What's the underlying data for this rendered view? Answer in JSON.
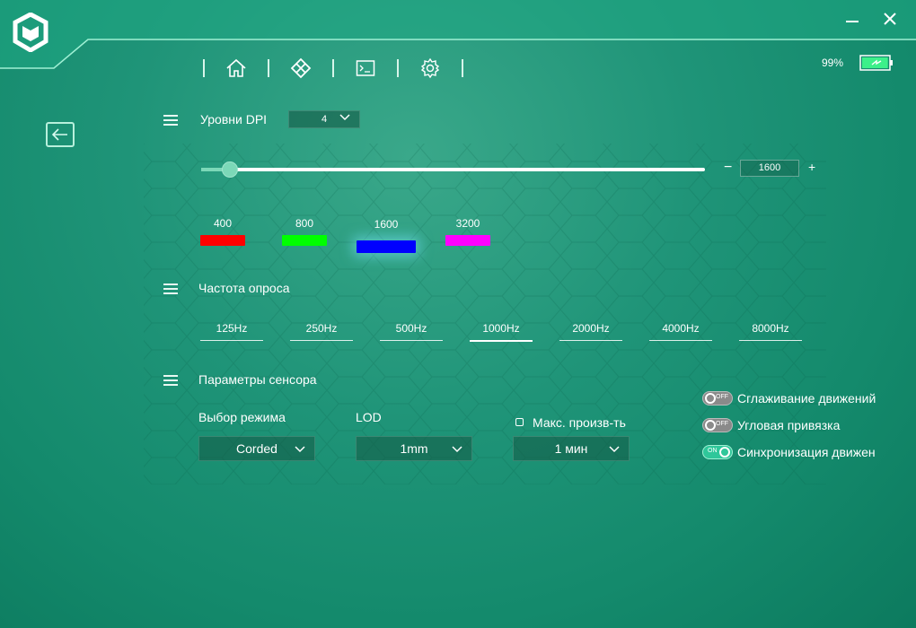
{
  "window": {
    "battery_percent": "99%",
    "battery_level": 0.99
  },
  "nav": {
    "icons": [
      "home-icon",
      "grid-icon",
      "terminal-icon",
      "gear-icon"
    ]
  },
  "dpi": {
    "title": "Уровни DPI",
    "levels_count": "4",
    "slider_value": "1600",
    "slider_min": 100,
    "slider_max": 26000,
    "minus": "−",
    "plus": "+",
    "levels": [
      {
        "label": "400",
        "color": "#ff0000"
      },
      {
        "label": "800",
        "color": "#00ff00"
      },
      {
        "label": "1600",
        "color": "#0000ff",
        "selected": true
      },
      {
        "label": "3200",
        "color": "#ff00ff"
      }
    ]
  },
  "polling": {
    "title": "Частота опроса",
    "rates": [
      "125Hz",
      "250Hz",
      "500Hz",
      "1000Hz",
      "2000Hz",
      "4000Hz",
      "8000Hz"
    ],
    "selected": "1000Hz"
  },
  "sensor": {
    "title": "Параметры сенсора",
    "mode_label": "Выбор режима",
    "mode_value": "Corded",
    "lod_label": "LOD",
    "lod_value": "1mm",
    "max_perf_label": "Макс. произв-ть",
    "max_perf_value": "1 мин",
    "toggles": [
      {
        "label": "Сглаживание движений",
        "state": "OFF"
      },
      {
        "label": "Угловая привязка",
        "state": "OFF"
      },
      {
        "label": "Синхронизация движен",
        "state": "ON"
      }
    ]
  }
}
